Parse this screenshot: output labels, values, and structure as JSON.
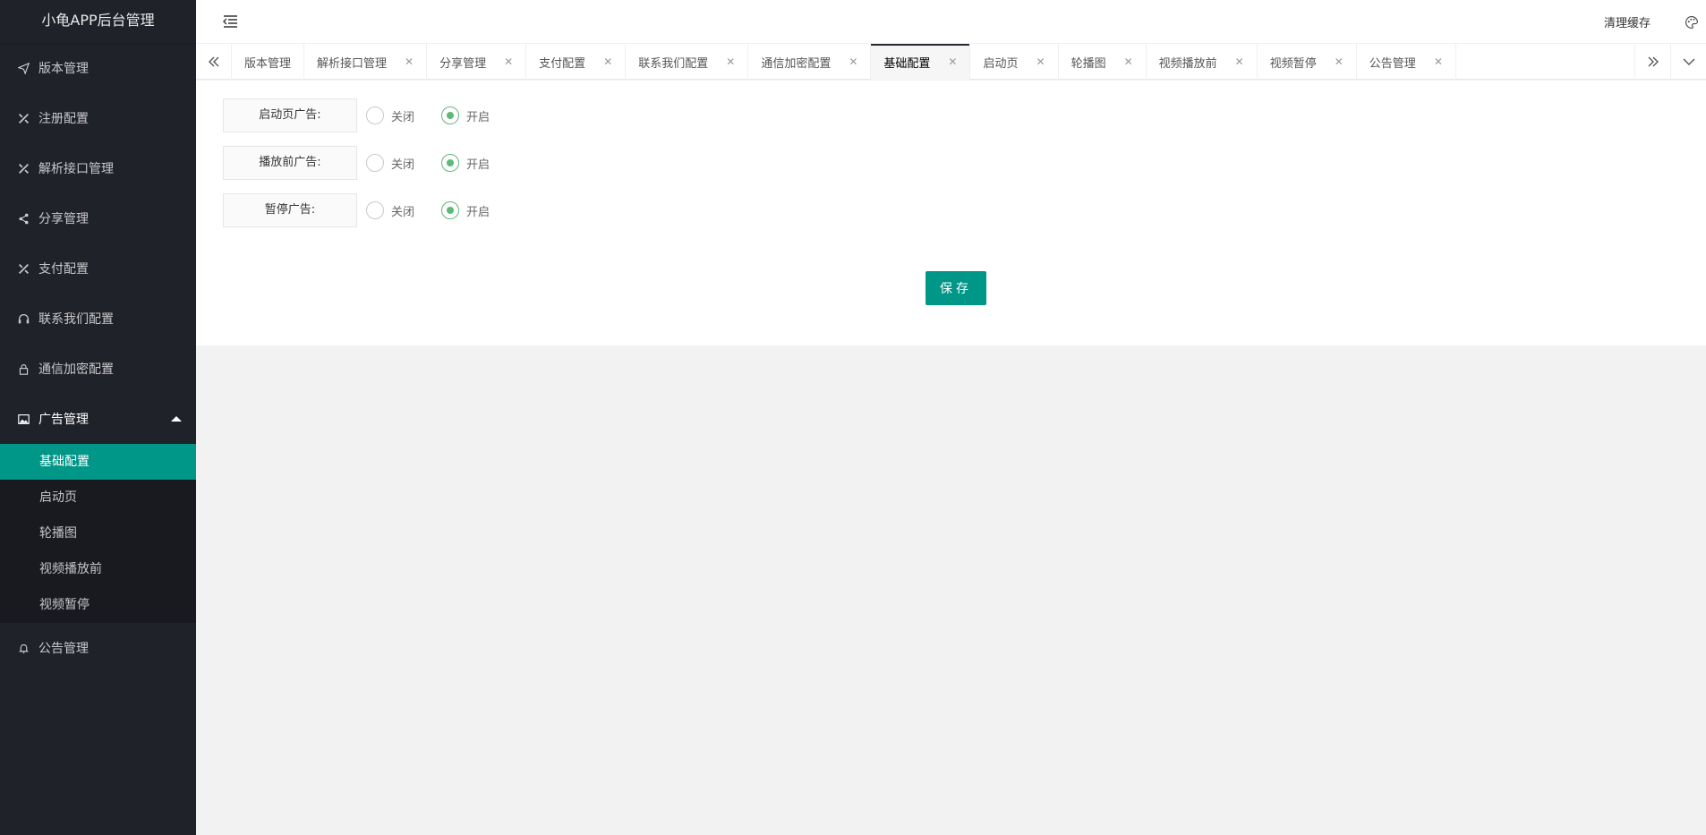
{
  "app": {
    "title": "小龟APP后台管理"
  },
  "sidebar": {
    "items": [
      {
        "label": "版本管理",
        "icon": "send-icon"
      },
      {
        "label": "注册配置",
        "icon": "tools-icon"
      },
      {
        "label": "解析接口管理",
        "icon": "tools-icon"
      },
      {
        "label": "分享管理",
        "icon": "share-icon"
      },
      {
        "label": "支付配置",
        "icon": "tools-icon"
      },
      {
        "label": "联系我们配置",
        "icon": "headset-icon"
      },
      {
        "label": "通信加密配置",
        "icon": "lock-icon"
      },
      {
        "label": "广告管理",
        "icon": "picture-icon"
      },
      {
        "label": "公告管理",
        "icon": "bell-icon"
      }
    ],
    "ad_submenu": [
      "基础配置",
      "启动页",
      "轮播图",
      "视频播放前",
      "视频暂停"
    ]
  },
  "header": {
    "clear_cache": "清理缓存"
  },
  "tabs": [
    {
      "label": "版本管理"
    },
    {
      "label": "解析接口管理"
    },
    {
      "label": "分享管理"
    },
    {
      "label": "支付配置"
    },
    {
      "label": "联系我们配置"
    },
    {
      "label": "通信加密配置"
    },
    {
      "label": "基础配置"
    },
    {
      "label": "启动页"
    },
    {
      "label": "轮播图"
    },
    {
      "label": "视频播放前"
    },
    {
      "label": "视频暂停"
    },
    {
      "label": "公告管理"
    }
  ],
  "form": {
    "rows": [
      {
        "label": "启动页广告:",
        "off": "关闭",
        "on": "开启",
        "selected": "on"
      },
      {
        "label": "播放前广告:",
        "off": "关闭",
        "on": "开启",
        "selected": "on"
      },
      {
        "label": "暂停广告:",
        "off": "关闭",
        "on": "开启",
        "selected": "on"
      }
    ],
    "save": "保存"
  },
  "colors": {
    "accent": "#009688",
    "radio_on": "#5fb878",
    "sidebar_bg": "#20222a"
  }
}
